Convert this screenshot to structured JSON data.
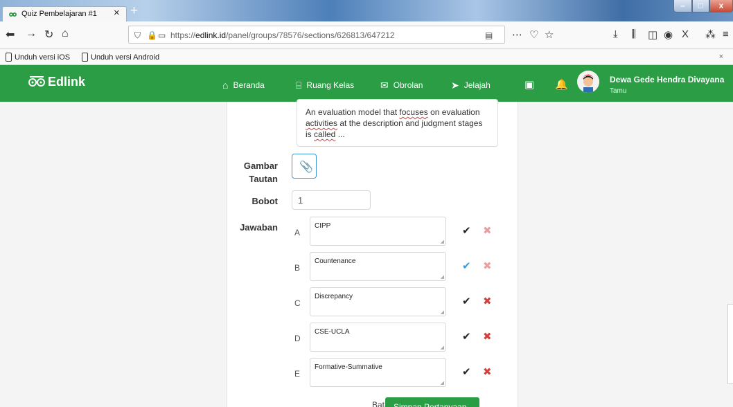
{
  "browser": {
    "tab_title": "Quiz Pembelajaran #1",
    "tab_close": "×",
    "new_tab": "+",
    "url_domain": "edlink.id",
    "url_prefix": "https://",
    "url_path": "/panel/groups/78576/sections/626813/647212",
    "bookmarks": [
      "Unduh versi iOS",
      "Unduh versi Android"
    ],
    "bookmark_close": "×"
  },
  "header": {
    "logo_text": "Edlink",
    "menu": [
      {
        "label": "Beranda",
        "icon": "home-icon"
      },
      {
        "label": "Ruang Kelas",
        "icon": "classroom-icon"
      },
      {
        "label": "Obrolan",
        "icon": "chat-icon"
      },
      {
        "label": "Jelajah",
        "icon": "explore-icon"
      }
    ],
    "user_name": "Dewa Gede Hendra Divayana",
    "user_role": "Tamu"
  },
  "question": {
    "text_parts": [
      "An evaluation model that ",
      "focuses",
      " on evaluation ",
      "activities",
      " at the description and judgment stages is ",
      "called",
      " ..."
    ]
  },
  "form": {
    "image_label": "Gambar",
    "link_label": "Tautan",
    "weight_label": "Bobot",
    "weight_value": "1",
    "answers_label": "Jawaban",
    "answers": [
      {
        "letter": "A",
        "text": "CIPP",
        "correct": false
      },
      {
        "letter": "B",
        "text": "Countenance",
        "correct": true
      },
      {
        "letter": "C",
        "text": "Discrepancy",
        "correct": false
      },
      {
        "letter": "D",
        "text": "CSE-UCLA",
        "correct": false
      },
      {
        "letter": "E",
        "text": "Formative-Summative",
        "correct": false
      }
    ],
    "cancel_label": "Batal",
    "save_label": "Simpan Pertanyaan"
  },
  "colors": {
    "brand_green": "#2a9d45",
    "accent_blue": "#2a9de0",
    "delete_red": "#d24040"
  }
}
